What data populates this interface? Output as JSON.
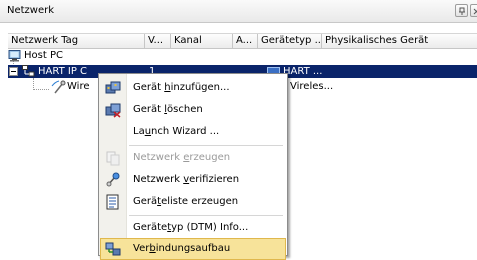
{
  "window": {
    "title": "Netzwerk"
  },
  "columns": [
    {
      "label": "Netzwerk Tag"
    },
    {
      "label": "V..."
    },
    {
      "label": "Kanal"
    },
    {
      "label": "A..."
    },
    {
      "label": "Gerätetyp ..."
    },
    {
      "label": "Physikalisches Gerät"
    }
  ],
  "tree": {
    "host": {
      "label": "Host PC"
    },
    "hart_node": {
      "label": "HART IP C",
      "version": "1",
      "device_type": "HART ..."
    },
    "wireless_node": {
      "label": "Wire",
      "device_type": "Vireles..."
    }
  },
  "context_menu": {
    "items": [
      {
        "label": "Gerät hinzufügen...",
        "icon": "add-device-icon",
        "disabled": false
      },
      {
        "label": "Gerät löschen",
        "icon": "delete-device-icon",
        "disabled": false
      },
      {
        "label": "Launch Wizard ...",
        "icon": "",
        "disabled": false
      },
      {
        "label": "Netzwerk erzeugen",
        "icon": "create-network-icon",
        "disabled": true
      },
      {
        "label": "Netzwerk verifizieren",
        "icon": "verify-network-icon",
        "disabled": false
      },
      {
        "label": "Geräteliste erzeugen",
        "icon": "device-list-icon",
        "disabled": false
      },
      {
        "label": "Gerätetyp (DTM) Info...",
        "icon": "",
        "disabled": false
      },
      {
        "label": "Verbindungsaufbau",
        "icon": "connect-icon",
        "disabled": false,
        "highlighted": true
      }
    ]
  },
  "colors": {
    "selection": "#0a246a",
    "menu_highlight": "#f7e39a"
  }
}
